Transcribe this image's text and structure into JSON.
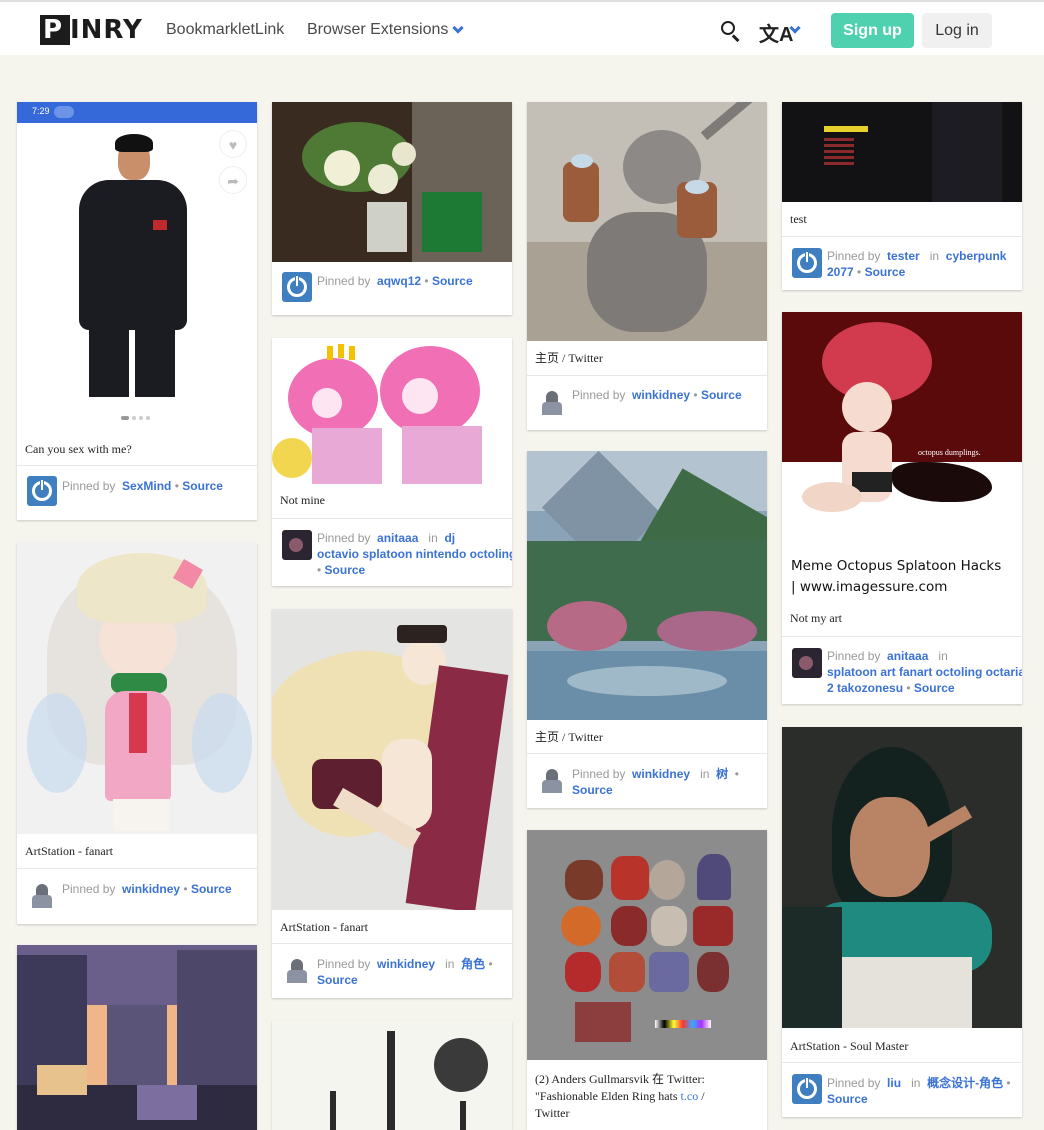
{
  "navbar": {
    "logo": "PINRY",
    "bookmarklet": "BookmarkletLink",
    "extensions": "Browser Extensions",
    "signup": "Sign up",
    "login": "Log in",
    "translate_glyph": "文A",
    "icons": [
      "search-icon",
      "translate-icon",
      "chevron-down-icon"
    ]
  },
  "pinned_by": "Pinned by",
  "in_word": "in",
  "source": "Source",
  "colors": {
    "accent": "#3b73d4",
    "signup": "#4fd1b0",
    "background": "#f5f4ed"
  },
  "cards": {
    "c1": {
      "phone_time": "7:29",
      "desc": "Can you sex with me?",
      "user": "SexMind"
    },
    "c2": {
      "desc": "ArtStation - fanart",
      "user": "winkidney"
    },
    "c4": {
      "user": "aqwq12"
    },
    "c5": {
      "desc": "Not mine",
      "user": "anitaaa",
      "boards_line1": "dj",
      "boards_line2": "octavio splatoon nintendo octolings ja"
    },
    "c6": {
      "desc": "ArtStation - fanart",
      "user": "winkidney",
      "board": "角色"
    },
    "c8": {
      "desc": "主页 / Twitter",
      "user": "winkidney"
    },
    "c9": {
      "desc": "主页 / Twitter",
      "user": "winkidney",
      "board": "树"
    },
    "c10": {
      "desc_line1": "(2) Anders Gullmarsvik 在 Twitter:",
      "desc_line2": "\"Fashionable Elden Ring hats",
      "desc_link": "t.co",
      "desc_tail": " /",
      "desc_line3": "Twitter"
    },
    "c11": {
      "desc": "test",
      "user": "tester",
      "board": "cyberpunk",
      "board_line2": "2077"
    },
    "c12": {
      "caption_line1": "Meme Octopus Splatoon Hacks",
      "caption_line2": "| www.imagessure.com",
      "desc": "Not my art",
      "user": "anitaaa",
      "boards_line2": "splatoon art fanart octoling octarian spl",
      "boards_line3a": "2 takozonesu"
    },
    "c13": {
      "desc": "ArtStation - Soul Master",
      "user": "liu",
      "board": "概念设计-角色"
    }
  }
}
